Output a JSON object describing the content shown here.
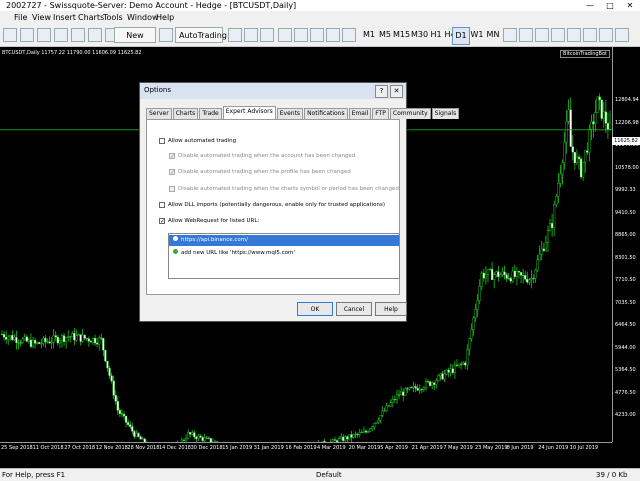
{
  "window": {
    "title": "2002727 - Swissquote-Server: Demo Account - Hedge - [BTCUSDT,Daily]",
    "min": "—",
    "max": "□",
    "close": "✕"
  },
  "menu": [
    "File",
    "View",
    "Insert",
    "Charts",
    "Tools",
    "Window",
    "Help"
  ],
  "toolbar": {
    "new_order": "New Order",
    "autotrading": "AutoTrading",
    "timeframes": [
      "M1",
      "M5",
      "M15",
      "M30",
      "H1",
      "H4",
      "D1",
      "W1",
      "MN"
    ],
    "active_timeframe": "D1"
  },
  "chart": {
    "header": "BTCUSDT,Daily  11757.22 11790.00 11606.09 11625.82",
    "ea_label": "BitcoinTradingBot",
    "current_price": "11625.82",
    "price_ticks": [
      "12804.94",
      "12206.98",
      "11149.56",
      "10578.00",
      "9992.33",
      "9410.50",
      "8865.00",
      "8301.50",
      "7710.50",
      "7035.50",
      "6464.50",
      "5944.00",
      "5364.50",
      "4776.50",
      "4233.00"
    ],
    "time_ticks": [
      "25 Sep 2018",
      "11 Oct 2018",
      "27 Oct 2018",
      "12 Nov 2018",
      "28 Nov 2018",
      "14 Dec 2018",
      "30 Dec 2018",
      "15 Jan 2019",
      "31 Jan 2019",
      "16 Feb 2019",
      "4 Mar 2019",
      "20 Mar 2019",
      "5 Apr 2019",
      "21 Apr 2019",
      "7 May 2019",
      "23 May 2019",
      "8 Jun 2019",
      "24 Jun 2019",
      "10 Jul 2019"
    ],
    "bull_color": "#22dd22",
    "bear_color": "#ffffff",
    "bid_line_color": "#22aa22"
  },
  "chart_data": {
    "type": "candlestick",
    "symbol": "BTCUSDT",
    "timeframe": "Daily",
    "x_start": "2018-09-25",
    "x_end": "2019-07-16",
    "ylim": [
      3800,
      13700
    ],
    "trend": [
      [
        "2018-09-25",
        6500
      ],
      [
        "2018-10-11",
        6250
      ],
      [
        "2018-10-27",
        6450
      ],
      [
        "2018-11-12",
        6350
      ],
      [
        "2018-11-20",
        4600
      ],
      [
        "2018-11-28",
        4000
      ],
      [
        "2018-12-07",
        3600
      ],
      [
        "2018-12-14",
        3400
      ],
      [
        "2018-12-24",
        4000
      ],
      [
        "2018-12-30",
        3900
      ],
      [
        "2019-01-15",
        3650
      ],
      [
        "2019-01-31",
        3450
      ],
      [
        "2019-02-16",
        3650
      ],
      [
        "2019-03-04",
        3800
      ],
      [
        "2019-03-20",
        4050
      ],
      [
        "2019-04-05",
        5000
      ],
      [
        "2019-04-21",
        5300
      ],
      [
        "2019-05-07",
        5800
      ],
      [
        "2019-05-15",
        8000
      ],
      [
        "2019-05-23",
        8000
      ],
      [
        "2019-06-08",
        7900
      ],
      [
        "2019-06-18",
        9300
      ],
      [
        "2019-06-26",
        12000
      ],
      [
        "2019-06-27",
        11200
      ],
      [
        "2019-07-02",
        10600
      ],
      [
        "2019-07-10",
        12300
      ],
      [
        "2019-07-16",
        11625
      ]
    ]
  },
  "dialog": {
    "title": "Options",
    "help_btn": "?",
    "close_btn": "✕",
    "tabs": [
      "Server",
      "Charts",
      "Trade",
      "Expert Advisors",
      "Events",
      "Notifications",
      "Email",
      "FTP",
      "Community",
      "Signals"
    ],
    "active_tab": "Expert Advisors",
    "options": [
      {
        "label": "Allow automated trading",
        "checked": false,
        "disabled": false,
        "indent": false
      },
      {
        "label": "Disable automated trading when the account has been changed",
        "checked": true,
        "disabled": true,
        "indent": true
      },
      {
        "label": "Disable automated trading when the profile has been changed",
        "checked": true,
        "disabled": true,
        "indent": true
      },
      {
        "label": "Disable automated trading when the charts symbol or period has been changed",
        "checked": false,
        "disabled": true,
        "indent": true
      },
      {
        "label": "Allow DLL imports (potentially dangerous, enable only for trusted applications)",
        "checked": false,
        "disabled": false,
        "indent": false
      },
      {
        "label": "Allow WebRequest for listed URL:",
        "checked": true,
        "disabled": false,
        "indent": false
      }
    ],
    "urls": [
      {
        "text": "https://api.binance.com/",
        "selected": true
      },
      {
        "text": "add new URL like 'https://www.mql5.com'",
        "selected": false
      }
    ],
    "ok": "OK",
    "cancel": "Cancel",
    "help": "Help",
    "check_mark": "✓"
  },
  "status": {
    "help": "For Help, press F1",
    "profile": "Default",
    "traffic": "39 / 0 Kb"
  }
}
